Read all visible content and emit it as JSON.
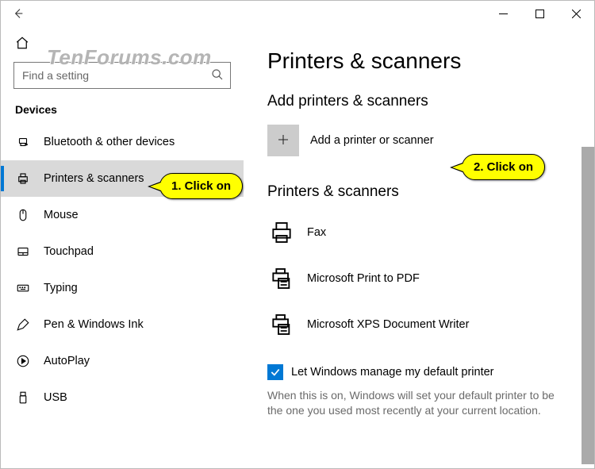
{
  "watermark": "TenForums.com",
  "search": {
    "placeholder": "Find a setting"
  },
  "category": "Devices",
  "sidebar": {
    "items": [
      {
        "label": "Bluetooth & other devices"
      },
      {
        "label": "Printers & scanners"
      },
      {
        "label": "Mouse"
      },
      {
        "label": "Touchpad"
      },
      {
        "label": "Typing"
      },
      {
        "label": "Pen & Windows Ink"
      },
      {
        "label": "AutoPlay"
      },
      {
        "label": "USB"
      }
    ]
  },
  "page": {
    "title": "Printers & scanners",
    "add_section": "Add printers & scanners",
    "add_label": "Add a printer or scanner",
    "list_section": "Printers & scanners",
    "printers": [
      {
        "label": "Fax"
      },
      {
        "label": "Microsoft Print to PDF"
      },
      {
        "label": "Microsoft XPS Document Writer"
      }
    ],
    "default_check": "Let Windows manage my default printer",
    "default_desc": "When this is on, Windows will set your default printer to be the one you used most recently at your current location."
  },
  "callouts": {
    "one": "1. Click on",
    "two": "2. Click on"
  }
}
